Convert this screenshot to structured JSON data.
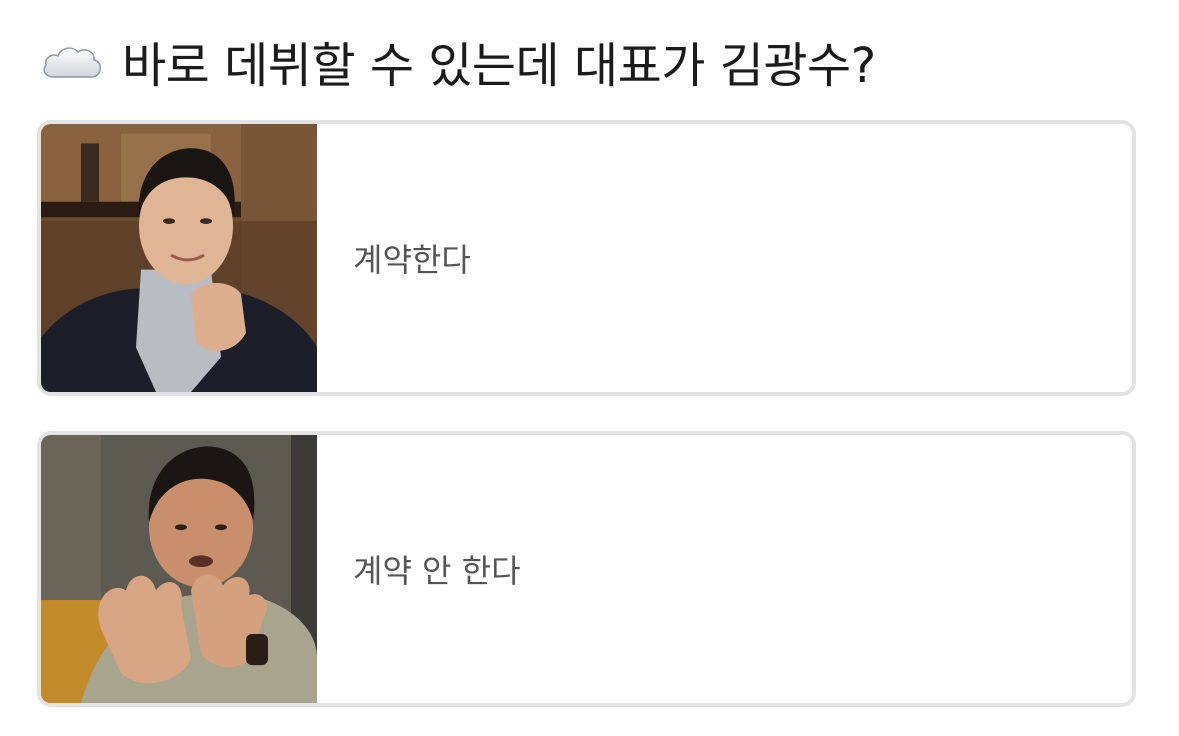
{
  "question": {
    "icon": "cloud-icon",
    "text": "바로 데뷔할 수 있는데 대표가 김광수?"
  },
  "options": [
    {
      "label": "계약한다",
      "photo": "portrait-photo-man-turtleneck"
    },
    {
      "label": "계약 안 한다",
      "photo": "portrait-photo-man-gesturing"
    }
  ],
  "colors": {
    "card_border": "#e3e3e3",
    "label_text": "#555555",
    "title_text": "#1b1b1b"
  }
}
